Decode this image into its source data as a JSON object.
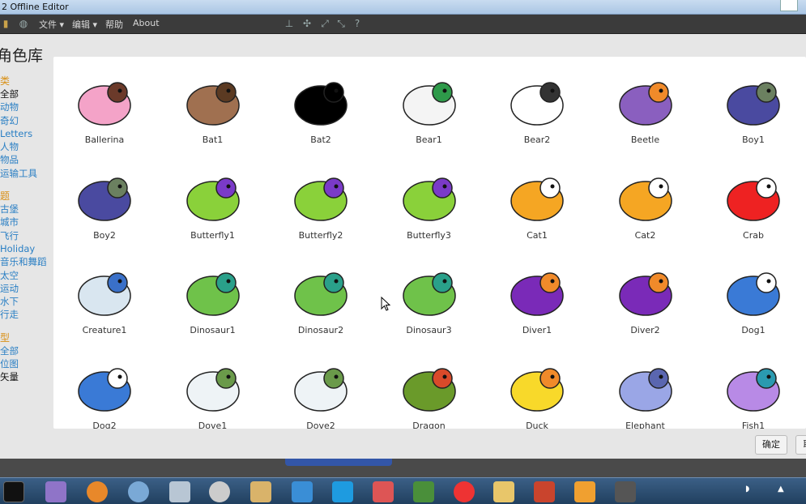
{
  "window": {
    "title": "2 Offline Editor"
  },
  "menu": {
    "file": "文件 ▾",
    "edit": "编辑 ▾",
    "help": "帮助",
    "about": "About"
  },
  "dialog": {
    "title": "角色库",
    "sidebar": {
      "category_header": "类",
      "categories": [
        "全部",
        "动物",
        "奇幻",
        "Letters",
        "人物",
        "物品",
        "运输工具"
      ],
      "theme_header": "题",
      "themes": [
        "古堡",
        "城市",
        "飞行",
        "Holiday",
        "音乐和舞蹈",
        "太空",
        "运动",
        "水下",
        "行走"
      ],
      "type_header": "型",
      "types": [
        "全部",
        "位图",
        "矢量"
      ]
    },
    "sprites": [
      {
        "name": "Ballerina",
        "icon": "ballerina-icon"
      },
      {
        "name": "Bat1",
        "icon": "bat-icon"
      },
      {
        "name": "Bat2",
        "icon": "bat-silhouette-icon"
      },
      {
        "name": "Bear1",
        "icon": "polar-bear-icon"
      },
      {
        "name": "Bear2",
        "icon": "bear-outline-icon"
      },
      {
        "name": "Beetle",
        "icon": "beetle-icon"
      },
      {
        "name": "Boy1",
        "icon": "boy-icon"
      },
      {
        "name": "Boy2",
        "icon": "boy-icon"
      },
      {
        "name": "Butterfly1",
        "icon": "butterfly-icon"
      },
      {
        "name": "Butterfly2",
        "icon": "butterfly-icon"
      },
      {
        "name": "Butterfly3",
        "icon": "butterfly-icon"
      },
      {
        "name": "Cat1",
        "icon": "cat-icon"
      },
      {
        "name": "Cat2",
        "icon": "cat-icon"
      },
      {
        "name": "Crab",
        "icon": "crab-icon"
      },
      {
        "name": "Creature1",
        "icon": "creature-icon"
      },
      {
        "name": "Dinosaur1",
        "icon": "dinosaur-icon"
      },
      {
        "name": "Dinosaur2",
        "icon": "dinosaur-icon"
      },
      {
        "name": "Dinosaur3",
        "icon": "dinosaur-icon"
      },
      {
        "name": "Diver1",
        "icon": "diver-icon"
      },
      {
        "name": "Diver2",
        "icon": "diver-icon"
      },
      {
        "name": "Dog1",
        "icon": "dog-icon"
      },
      {
        "name": "Dog2",
        "icon": "dog-icon"
      },
      {
        "name": "Dove1",
        "icon": "dove-icon"
      },
      {
        "name": "Dove2",
        "icon": "dove-icon"
      },
      {
        "name": "Dragon",
        "icon": "dragon-icon"
      },
      {
        "name": "Duck",
        "icon": "duck-icon"
      },
      {
        "name": "Elephant",
        "icon": "elephant-icon"
      },
      {
        "name": "Fish1",
        "icon": "fish-icon"
      }
    ],
    "ok_button": "确定",
    "cancel_button": "取"
  },
  "colors": {
    "accent": "#d99016",
    "link": "#2a7fc4",
    "menubar": "#3b3b3b"
  }
}
